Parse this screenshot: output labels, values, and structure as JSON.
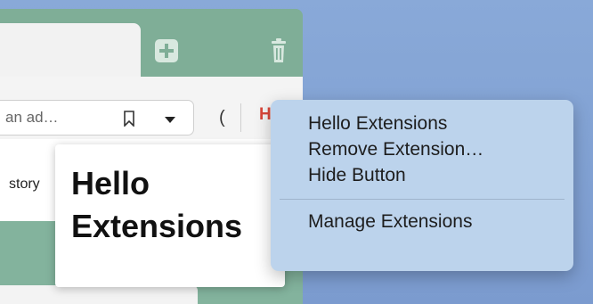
{
  "browser": {
    "address_bar": {
      "placeholder_fragment": "an ad…"
    },
    "toolbar": {
      "reload_fragment": "(",
      "extension_button_fragment": "Hi"
    },
    "content": {
      "history_fragment": "story"
    }
  },
  "popup": {
    "title": "Hello\nExtensions"
  },
  "context_menu": {
    "items": [
      {
        "label": "Hello Extensions"
      },
      {
        "label": "Remove Extension…"
      },
      {
        "label": "Hide Button"
      },
      {
        "label": "Manage Extensions"
      }
    ]
  },
  "icons": {
    "new_tab": "plus-icon",
    "trash": "trash-icon",
    "bookmark": "bookmark-icon",
    "dropdown": "chevron-down-icon"
  },
  "colors": {
    "tab_strip": "#7fae97",
    "desktop": "#7f9fd1",
    "menu_bg": "#bcd3ec",
    "accent_red": "#d9473a"
  }
}
